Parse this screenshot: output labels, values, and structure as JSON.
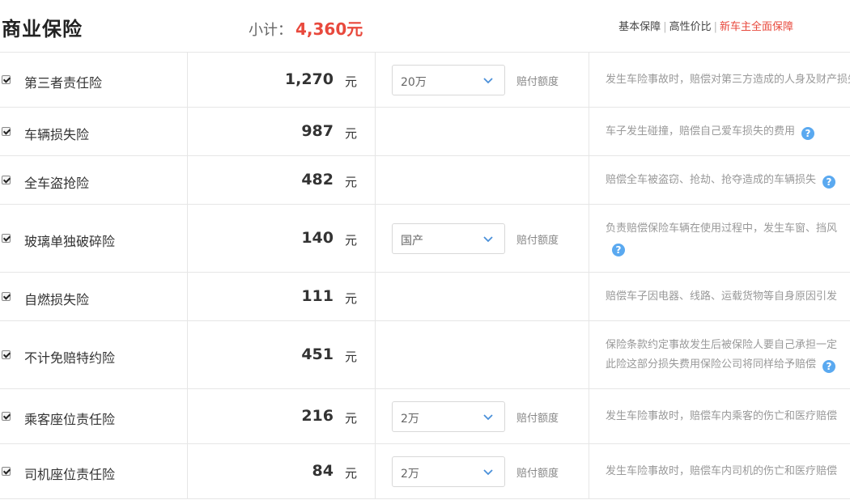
{
  "header": {
    "title": "商业保险",
    "subtotal_label": "小计：",
    "subtotal_value": "4,360元",
    "plans": [
      "基本保障",
      "高性价比",
      "新车主全面保障"
    ]
  },
  "colors": {
    "accent": "#e8493d",
    "help": "#5aa9f0"
  },
  "rows": [
    {
      "name": "第三者责任险",
      "price": "1,270",
      "unit": "元",
      "select": "20万",
      "limit_label": "赔付额度",
      "desc": [
        "发生车险事故时，赔偿对第三方造成的人身及财产损失"
      ],
      "help": false,
      "checked": true
    },
    {
      "name": "车辆损失险",
      "price": "987",
      "unit": "元",
      "select": null,
      "limit_label": null,
      "desc": [
        "车子发生碰撞，赔偿自己爱车损失的费用"
      ],
      "help": true,
      "checked": true
    },
    {
      "name": "全车盗抢险",
      "price": "482",
      "unit": "元",
      "select": null,
      "limit_label": null,
      "desc": [
        "赔偿全车被盗窃、抢劫、抢夺造成的车辆损失"
      ],
      "help": true,
      "checked": true
    },
    {
      "name": "玻璃单独破碎险",
      "price": "140",
      "unit": "元",
      "select": "国产",
      "limit_label": "赔付额度",
      "desc": [
        "负责赔偿保险车辆在使用过程中，发生车窗、挡风",
        ""
      ],
      "help": true,
      "checked": true
    },
    {
      "name": "自燃损失险",
      "price": "111",
      "unit": "元",
      "select": null,
      "limit_label": null,
      "desc": [
        "赔偿车子因电器、线路、运载货物等自身原因引发"
      ],
      "help": false,
      "checked": true
    },
    {
      "name": "不计免赔特约险",
      "price": "451",
      "unit": "元",
      "select": null,
      "limit_label": null,
      "desc": [
        "保险条款约定事故发生后被保险人要自己承担一定",
        "此险这部分损失费用保险公司将同样给予赔偿"
      ],
      "help": true,
      "checked": true
    },
    {
      "name": "乘客座位责任险",
      "price": "216",
      "unit": "元",
      "select": "2万",
      "limit_label": "赔付额度",
      "desc": [
        "发生车险事故时，赔偿车内乘客的伤亡和医疗赔偿"
      ],
      "help": false,
      "checked": true
    },
    {
      "name": "司机座位责任险",
      "price": "84",
      "unit": "元",
      "select": "2万",
      "limit_label": "赔付额度",
      "desc": [
        "发生车险事故时，赔偿车内司机的伤亡和医疗赔偿"
      ],
      "help": false,
      "checked": true
    }
  ]
}
